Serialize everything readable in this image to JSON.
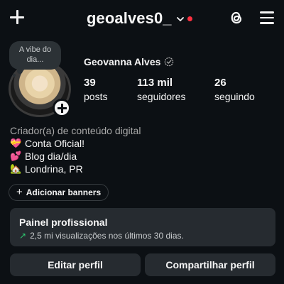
{
  "header": {
    "username": "geoalves0_",
    "accent_dot_color": "#ff3040"
  },
  "profile": {
    "note": "A vibe do dia...",
    "full_name": "Geovanna Alves",
    "stats": [
      {
        "value": "39",
        "label": "posts"
      },
      {
        "value": "113 mil",
        "label": "seguidores"
      },
      {
        "value": "26",
        "label": "seguindo"
      }
    ],
    "category": "Criador(a) de conteúdo digital",
    "bio": [
      {
        "emoji": "💝",
        "text": "Conta Oficial!"
      },
      {
        "emoji": "💕",
        "text": "Blog dia/dia"
      },
      {
        "emoji": "🏡",
        "text": "Londrina, PR"
      }
    ]
  },
  "banners_button": "Adicionar banners",
  "pro_panel": {
    "title": "Painel profissional",
    "subtitle": "2,5 mi visualizações nos últimos 30 dias."
  },
  "actions": {
    "edit": "Editar perfil",
    "share": "Compartilhar perfil"
  },
  "icons": [
    "plus-icon",
    "chevron-down-icon",
    "threads-icon",
    "hamburger-menu-icon",
    "verified-icon",
    "trending-up-arrow-icon"
  ]
}
